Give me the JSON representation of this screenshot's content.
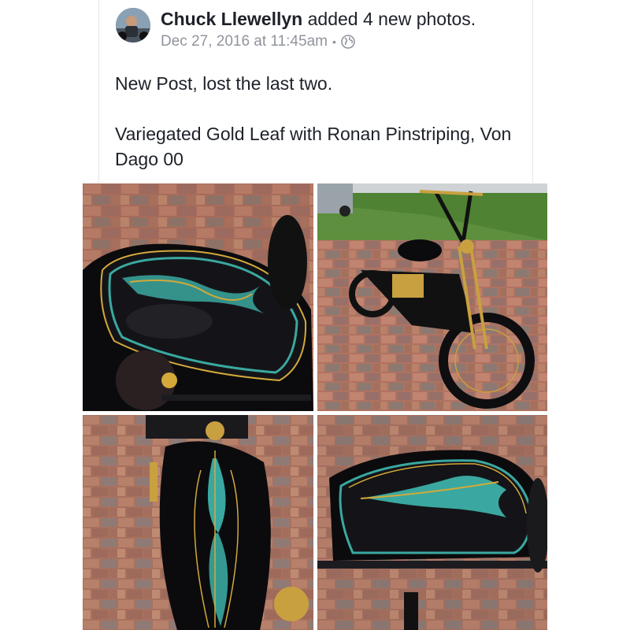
{
  "post": {
    "author": "Chuck Llewellyn",
    "action": "added 4 new photos.",
    "timestamp": "Dec 27, 2016 at 11:45am",
    "separator": "•",
    "privacy_icon": "globe-icon",
    "text_line1": "New Post, lost the last two.",
    "text_line2": "Variegated Gold Leaf with Ronan Pinstriping, Von Dago 00"
  },
  "photos": [
    {
      "subject": "rear-fender-pinstripe"
    },
    {
      "subject": "bobber-motorcycle-side"
    },
    {
      "subject": "gas-tank-pinstripe"
    },
    {
      "subject": "fender-pinstripe-side"
    }
  ],
  "colors": {
    "text": "#1d2129",
    "meta": "#90949c",
    "pinstripe_teal": "#3aa8a0",
    "pinstripe_gold": "#d4a93a",
    "paint_black": "#0b0b0d",
    "brick": "#b0705a"
  }
}
